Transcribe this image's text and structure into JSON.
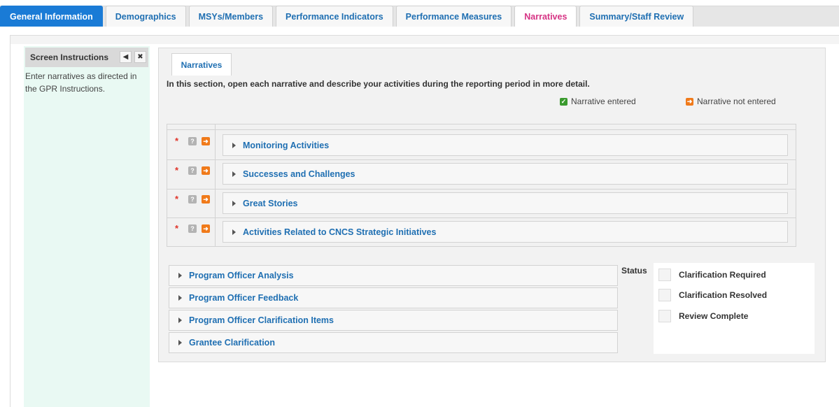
{
  "tabs": [
    {
      "label": "General Information",
      "state": "primary"
    },
    {
      "label": "Demographics",
      "state": "normal"
    },
    {
      "label": "MSYs/Members",
      "state": "normal"
    },
    {
      "label": "Performance Indicators",
      "state": "normal"
    },
    {
      "label": "Performance Measures",
      "state": "normal"
    },
    {
      "label": "Narratives",
      "state": "active"
    },
    {
      "label": "Summary/Staff Review",
      "state": "normal"
    }
  ],
  "sidebar": {
    "title": "Screen Instructions",
    "collapse_icon": "triangle-left-icon",
    "close_icon": "close-icon",
    "text": "Enter narratives as directed in the GPR Instructions."
  },
  "panel": {
    "tab_label": "Narratives",
    "intro": "In this section, open each narrative and describe your activities during the reporting period in more detail."
  },
  "legend": {
    "entered": "Narrative entered",
    "not_entered": "Narrative not entered"
  },
  "narratives": [
    {
      "label": "Monitoring Activities",
      "required": "*"
    },
    {
      "label": "Successes and Challenges",
      "required": "*"
    },
    {
      "label": "Great Stories",
      "required": "*"
    },
    {
      "label": "Activities Related to CNCS Strategic Initiatives",
      "required": "*"
    }
  ],
  "officer_sections": [
    {
      "label": "Program Officer Analysis"
    },
    {
      "label": "Program Officer Feedback"
    },
    {
      "label": "Program Officer Clarification Items"
    },
    {
      "label": "Grantee Clarification"
    }
  ],
  "status": {
    "label": "Status",
    "options": [
      {
        "label": "Clarification Required",
        "checked": false
      },
      {
        "label": "Clarification Resolved",
        "checked": false
      },
      {
        "label": "Review Complete",
        "checked": false
      }
    ]
  },
  "colors": {
    "tab_primary": "#1a7bd6",
    "tab_active_text": "#d63384",
    "link_blue": "#1f6fb2",
    "entered_green": "#3a9a2e",
    "not_entered_orange": "#f07a1a",
    "sidebar_bg": "#e9f9f3"
  }
}
